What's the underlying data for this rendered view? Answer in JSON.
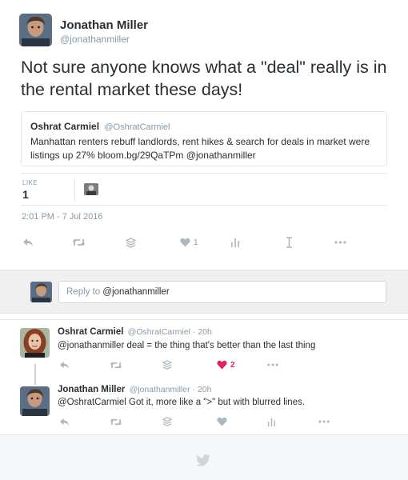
{
  "tweet": {
    "author_name": "Jonathan Miller",
    "author_handle": "@jonathanmiller",
    "text": "Not sure anyone knows what a \"deal\" really is in the rental market these days!",
    "timestamp": "2:01 PM - 7 Jul 2016",
    "like_label": "LIKE",
    "like_count": "1",
    "action_like_count": "1"
  },
  "quote": {
    "name": "Oshrat Carmiel",
    "handle": "@OshratCarmiel",
    "text": "Manhattan renters rebuff landlords, rent hikes & search for deals in market were listings up 27%   bloom.bg/29QaTPm @jonathanmiller"
  },
  "reply_box": {
    "placeholder_prefix": "Reply to",
    "mention": "@jonathanmiller"
  },
  "replies": [
    {
      "name": "Oshrat Carmiel",
      "meta": "@OshratCarmiel · 20h",
      "text": "@jonathanmiller deal = the thing that's better than the last thing",
      "like_count": "2"
    },
    {
      "name": "Jonathan Miller",
      "meta": "@jonathanmiller · 20h",
      "text": "@OshratCarmiel Got it, more like a \">\" but with blurred lines."
    }
  ],
  "colors": {
    "icon_gray": "#aab8c2",
    "like_red": "#e0245e",
    "text": "#292f33",
    "muted": "#8899a6"
  },
  "icons": [
    "reply-icon",
    "retweet-icon",
    "stack-icon",
    "heart-icon",
    "analytics-icon",
    "text-cursor-icon",
    "more-icon",
    "twitter-bird-icon"
  ]
}
